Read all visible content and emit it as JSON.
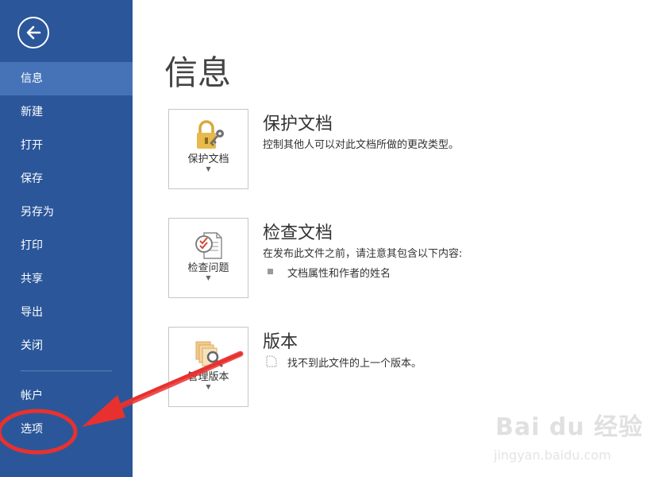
{
  "sidebar": {
    "items": [
      {
        "label": "信息"
      },
      {
        "label": "新建"
      },
      {
        "label": "打开"
      },
      {
        "label": "保存"
      },
      {
        "label": "另存为"
      },
      {
        "label": "打印"
      },
      {
        "label": "共享"
      },
      {
        "label": "导出"
      },
      {
        "label": "关闭"
      },
      {
        "label": "帐户"
      },
      {
        "label": "选项"
      }
    ],
    "active_index": 0,
    "back_icon": "arrow-left-icon"
  },
  "main": {
    "title": "信息",
    "sections": [
      {
        "card_label": "保护文档",
        "title": "保护文档",
        "description": "控制其他人可以对此文档所做的更改类型。",
        "icon": "lock-key-icon"
      },
      {
        "card_label": "检查问题",
        "title": "检查文档",
        "description": "在发布此文件之前，请注意其包含以下内容:",
        "bullets": [
          "文档属性和作者的姓名"
        ],
        "icon": "inspect-document-icon"
      },
      {
        "card_label": "管理版本",
        "title": "版本",
        "bullets": [
          "找不到此文件的上一个版本。"
        ],
        "icon": "manage-versions-icon"
      }
    ]
  },
  "watermark": {
    "brand": "Bai du 经验",
    "url": "jingyan.baidu.com"
  },
  "colors": {
    "sidebar": "#2b579a",
    "sidebar_active": "#4673b8",
    "annotation": "#e8312f"
  }
}
